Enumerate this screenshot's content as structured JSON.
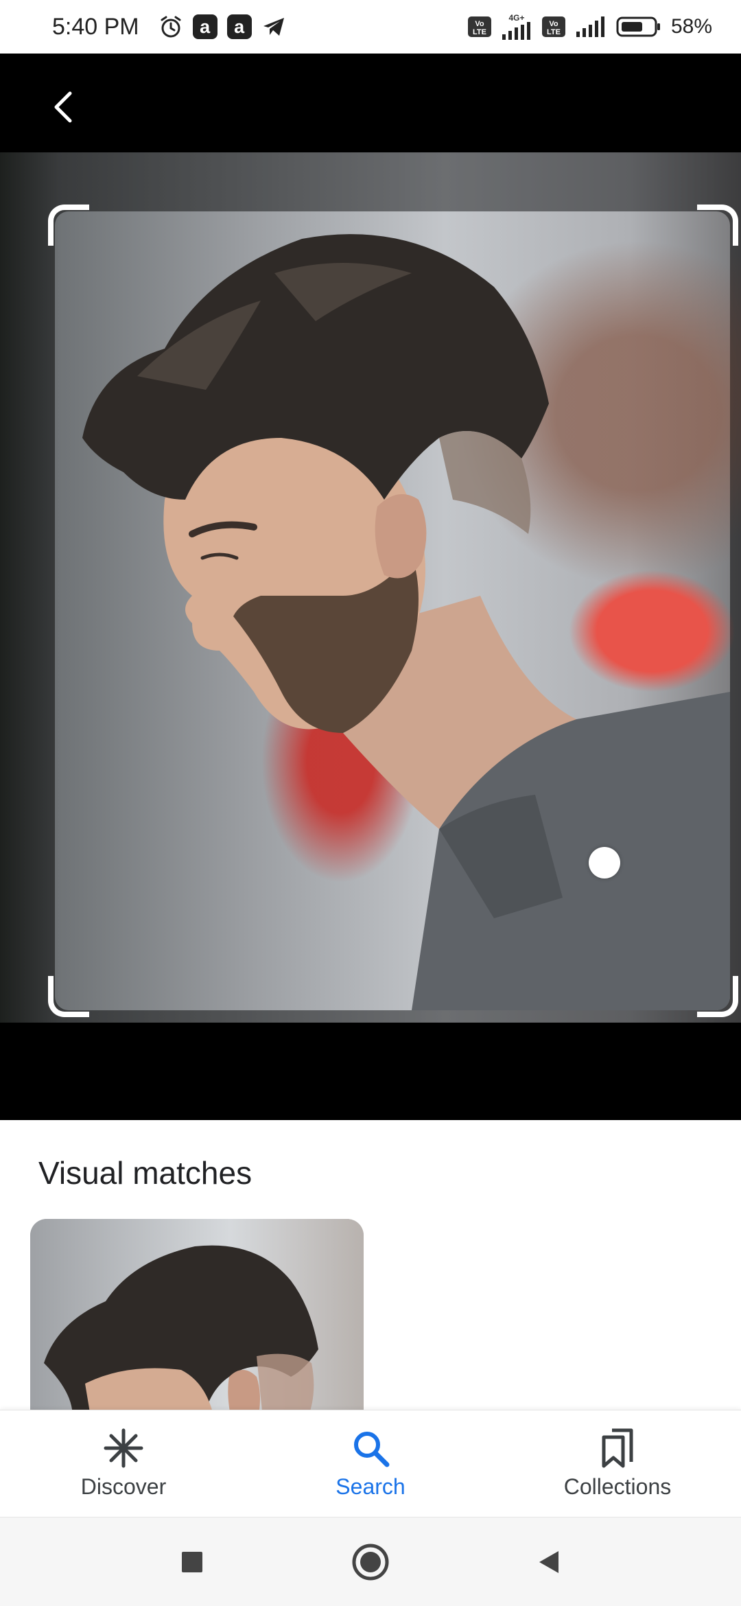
{
  "status_bar": {
    "time": "5:40 PM",
    "app_badge_1": "a",
    "app_badge_2": "a",
    "volte_1": "Vo LTE",
    "network_type": "4G+",
    "volte_2": "Vo LTE",
    "battery_percent": "58%",
    "icons": [
      "alarm-icon",
      "app-a-icon",
      "app-a-icon",
      "telegram-icon",
      "volte-icon",
      "signal-icon",
      "volte-icon",
      "signal-icon",
      "battery-icon"
    ]
  },
  "top_bar": {
    "back_icon": "chevron-left-icon"
  },
  "results": {
    "title": "Visual matches"
  },
  "bottom_nav": {
    "items": [
      {
        "label": "Discover",
        "icon": "asterisk-icon",
        "active": false
      },
      {
        "label": "Search",
        "icon": "search-icon",
        "active": true
      },
      {
        "label": "Collections",
        "icon": "collections-icon",
        "active": false
      }
    ]
  },
  "system_nav": {
    "icons": [
      "recents-square-icon",
      "home-circle-icon",
      "back-triangle-icon"
    ]
  },
  "colors": {
    "accent": "#1a73e8",
    "text_primary": "#202124",
    "nav_inactive": "#3c4043"
  }
}
